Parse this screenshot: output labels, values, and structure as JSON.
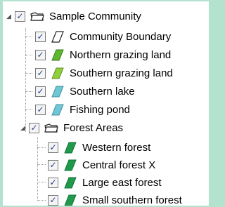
{
  "tree": {
    "root": {
      "label": "Sample Community",
      "checked": true,
      "expanded": true,
      "icon": "layer-group-icon"
    },
    "layers": [
      {
        "label": "Community Boundary",
        "checked": true,
        "icon": "polygon-icon",
        "color": "#ffffff"
      },
      {
        "label": "Northern grazing land",
        "checked": true,
        "icon": "polygon-icon",
        "color": "#5cb82f"
      },
      {
        "label": "Southern grazing land",
        "checked": true,
        "icon": "polygon-icon",
        "color": "#8fcf3c"
      },
      {
        "label": "Southern lake",
        "checked": true,
        "icon": "polygon-icon",
        "color": "#6fc7d6"
      },
      {
        "label": "Fishing pond",
        "checked": true,
        "icon": "polygon-icon",
        "color": "#6fc7d6"
      }
    ],
    "group": {
      "label": "Forest Areas",
      "checked": true,
      "expanded": true,
      "icon": "layer-group-icon",
      "children": [
        {
          "label": "Western forest",
          "checked": true,
          "icon": "polygon-icon",
          "color": "#1e9a4a"
        },
        {
          "label": "Central forest X",
          "checked": true,
          "icon": "polygon-icon",
          "color": "#1e9a4a"
        },
        {
          "label": "Large east forest",
          "checked": true,
          "icon": "polygon-icon",
          "color": "#1e9a4a"
        },
        {
          "label": "Small southern forest",
          "checked": true,
          "icon": "polygon-icon",
          "color": "#1e9a4a"
        }
      ]
    }
  }
}
